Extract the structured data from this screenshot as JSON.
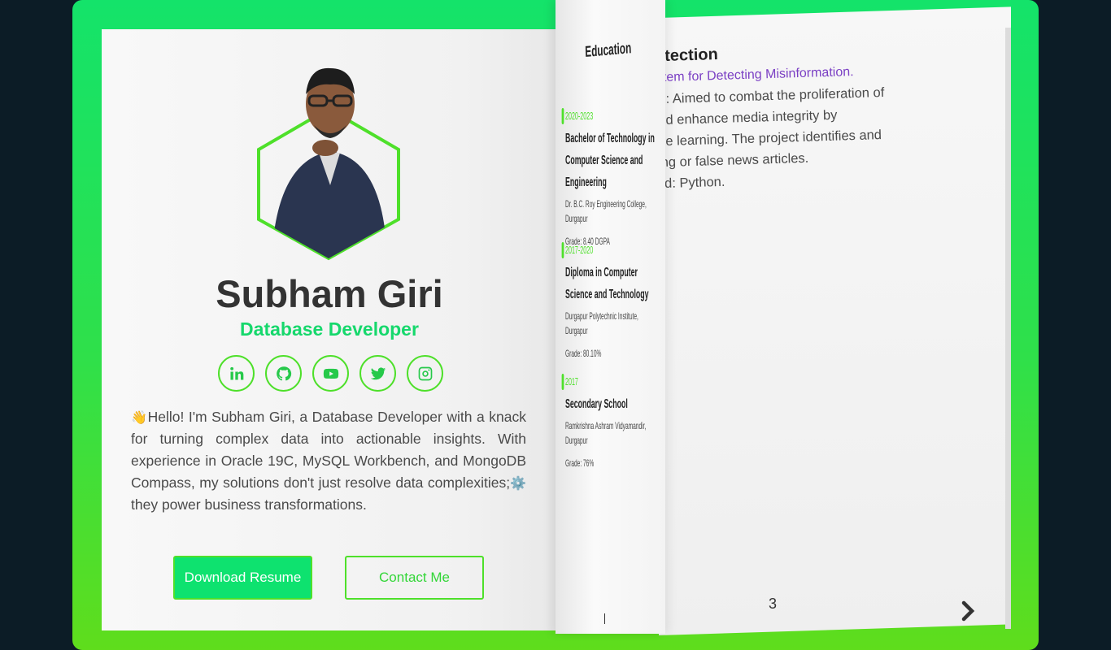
{
  "profile": {
    "name": "Subham Giri",
    "role": "Database Developer",
    "bio_emoji": "👋",
    "bio_part1": "Hello! I'm Subham Giri, a Database Developer with a knack for turning complex data into actionable insights. With experience in Oracle 19C, MySQL Workbench, and MongoDB Compass, my solutions don't just resolve data complexities;",
    "bio_gear": "⚙️",
    "bio_part2": " they power business transformations.",
    "socials": [
      {
        "icon": "linkedin-icon"
      },
      {
        "icon": "github-icon"
      },
      {
        "icon": "youtube-icon"
      },
      {
        "icon": "twitter-icon"
      },
      {
        "icon": "instagram-icon"
      }
    ],
    "buttons": {
      "download": "Download Resume",
      "contact": "Contact Me"
    }
  },
  "education": {
    "title": "Education",
    "items": [
      {
        "year": "2020-2023",
        "degree": "Bachelor of Technology in Computer Science and Engineering",
        "school": "Dr. B.C. Roy Engineering College, Durgapur",
        "grade": "Grade: 8.40 DGPA"
      },
      {
        "year": "2017-2020",
        "degree": "Diploma in Computer Science and Technology",
        "school": "Durgapur Polytechnic Institute, Durgapur",
        "grade": "Grade: 80.10%"
      },
      {
        "year": "2017",
        "degree": "Secondary School",
        "school": "Ramkrishna Ashram Vidyamandir, Durgapur",
        "grade": "Grade: 76%"
      }
    ]
  },
  "project": {
    "title": "ews Detection",
    "subtitle": "nced System for Detecting Misinformation.",
    "lines": [
      "Objective: Aimed to combat the proliferation of",
      "nation and enhance media integrity by",
      "g machine learning. The project identifies and",
      "misleading or false news articles.",
      "logy Used: Python."
    ],
    "page_number": "3"
  },
  "colors": {
    "accent_green": "#16d86c",
    "border_green": "#4ee02a",
    "subtitle_purple": "#7b40c4",
    "background": "#0c1c26"
  }
}
